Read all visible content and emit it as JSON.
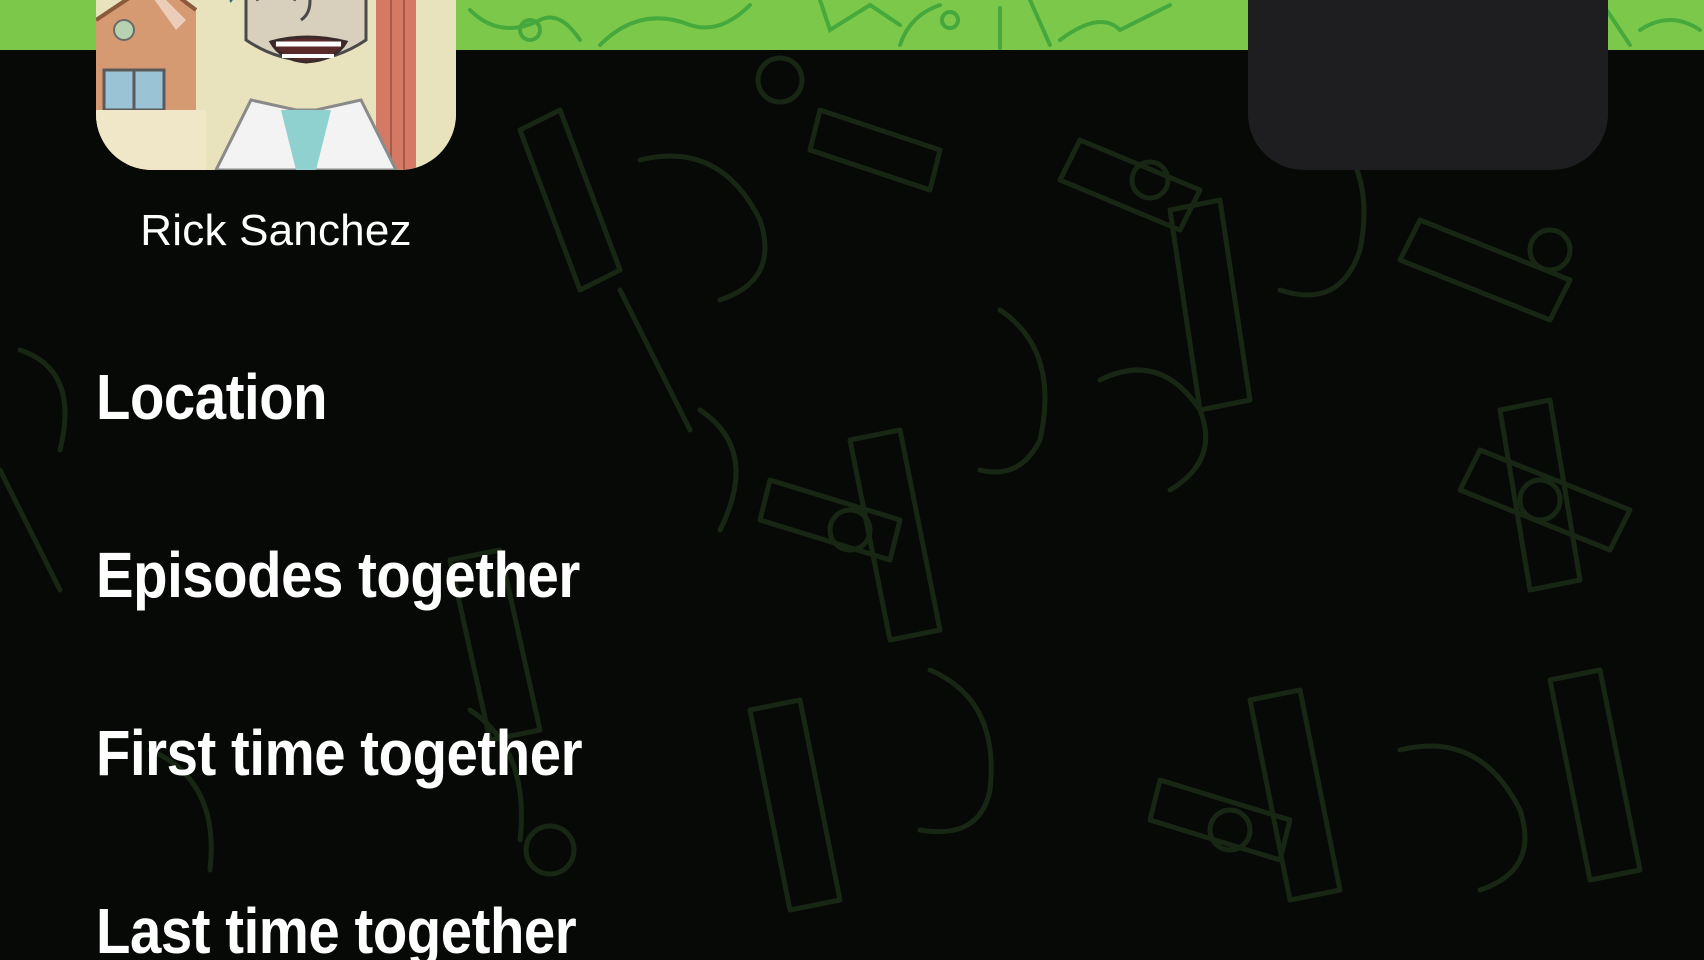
{
  "theme": {
    "header_green": "#7cc84a",
    "background": "#060906",
    "pattern_stroke": "#1a2a14",
    "card_dark": "#1e1e20",
    "text": "#ffffff"
  },
  "header": {
    "avatar_icon": "rick-portrait-image",
    "right_card_icon": "empty-card"
  },
  "character": {
    "name": "Rick Sanchez"
  },
  "sections": {
    "location": "Location",
    "episodes": "Episodes together",
    "first_time": "First time together",
    "last_time": "Last time together"
  }
}
